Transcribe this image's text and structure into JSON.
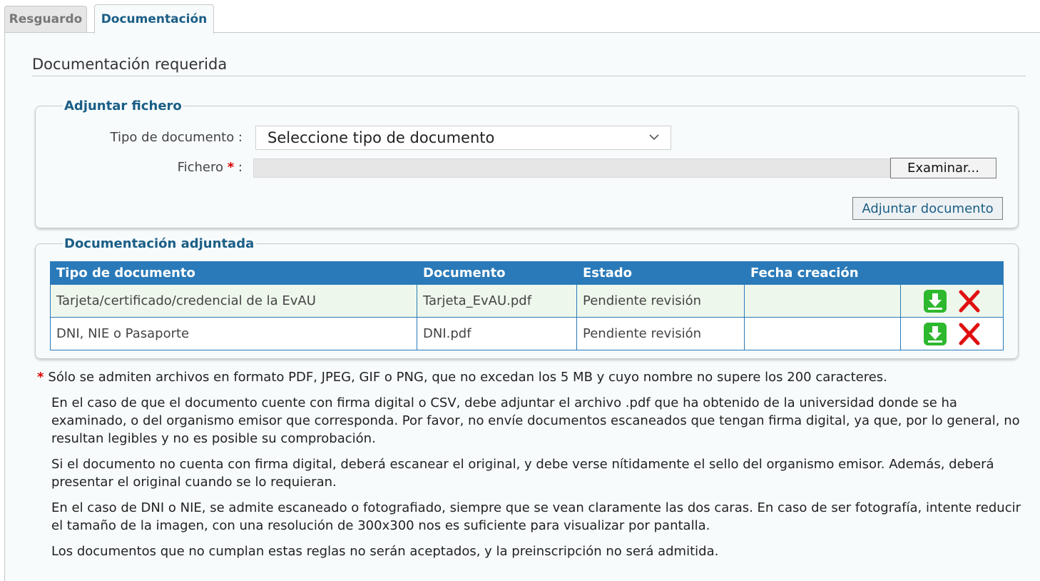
{
  "tabs": [
    {
      "label": "Resguardo",
      "active": false
    },
    {
      "label": "Documentación",
      "active": true
    }
  ],
  "section_title": "Documentación requerida",
  "upload": {
    "legend": "Adjuntar fichero",
    "doc_type_label": "Tipo de documento :",
    "doc_type_selected": "Seleccione tipo de documento",
    "file_label": "Fichero",
    "file_required_mark": "*",
    "file_colon": ":",
    "browse_button": "Examinar...",
    "attach_button": "Adjuntar documento"
  },
  "attached": {
    "legend": "Documentación adjuntada",
    "columns": [
      "Tipo de documento",
      "Documento",
      "Estado",
      "Fecha creación",
      ""
    ],
    "rows": [
      {
        "tipo": "Tarjeta/certificado/credencial de la EvAU",
        "documento": "Tarjeta_EvAU.pdf",
        "estado": "Pendiente revisión",
        "fecha": ""
      },
      {
        "tipo": "DNI, NIE o Pasaporte",
        "documento": "DNI.pdf",
        "estado": "Pendiente revisión",
        "fecha": ""
      }
    ]
  },
  "notes": {
    "star": "*",
    "lines": [
      "Sólo se admiten archivos en formato PDF, JPEG, GIF o PNG, que no excedan los 5 MB y cuyo nombre no supere los 200 caracteres.",
      "En el caso de que el documento cuente con firma digital o CSV, debe adjuntar el archivo .pdf que ha obtenido de la universidad donde se ha examinado, o del organismo emisor que corresponda. Por favor, no envíe documentos escaneados que tengan firma digital, ya que, por lo general, no resultan legibles y no es posible su comprobación.",
      "Si el documento no cuenta con firma digital, deberá escanear el original, y debe verse nítidamente el sello del organismo emisor. Además, deberá presentar el original cuando se lo requieran.",
      "En el caso de DNI o NIE, se admite escaneado o fotografiado, siempre que se vean claramente las dos caras. En caso de ser fotografía, intente reducir el tamaño de la imagen, con una resolución de 300x300 nos es suficiente para visualizar por pantalla.",
      "Los documentos que no cumplan estas reglas no serán aceptados, y la preinscripción no será admitida."
    ]
  },
  "colors": {
    "accent": "#1a5e86",
    "table_header": "#2a7ab9",
    "download_icon": "#2db82d",
    "delete_icon": "#e01010"
  },
  "icons": {
    "download": "download-icon",
    "delete": "delete-icon",
    "select": "chevron-down-icon"
  }
}
